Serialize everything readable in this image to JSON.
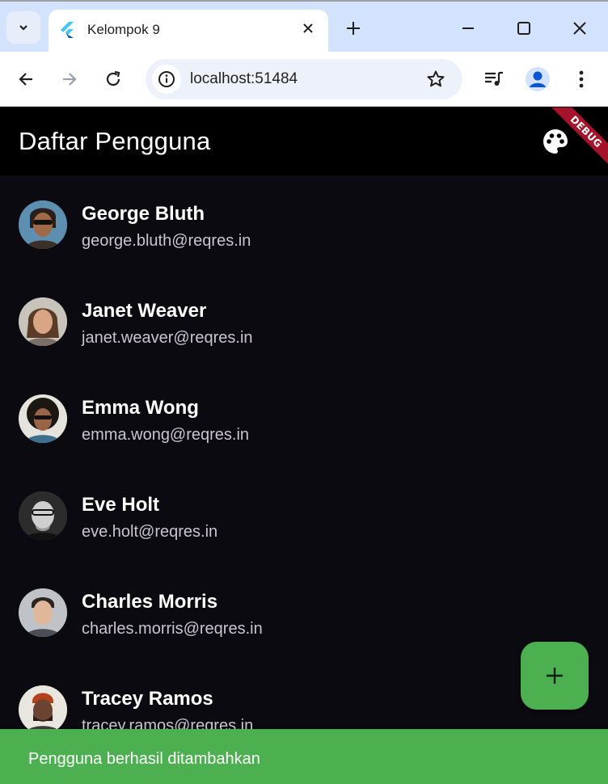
{
  "browser": {
    "tab_title": "Kelompok 9",
    "url": "localhost:51484",
    "icons": {
      "tab_search": "chevron-down-icon",
      "favicon": "flutter-icon",
      "tab_close": "close-icon",
      "new_tab": "plus-icon",
      "minimize": "minimize-icon",
      "maximize": "maximize-icon",
      "close_window": "close-icon",
      "back": "arrow-left-icon",
      "forward": "arrow-right-icon",
      "reload": "reload-icon",
      "site_info": "info-icon",
      "bookmark": "star-icon",
      "media": "media-queue-icon",
      "profile": "person-icon",
      "menu": "kebab-menu-icon"
    }
  },
  "app": {
    "title": "Daftar Pengguna",
    "debug_label": "DEBUG",
    "theme_icon": "palette-icon",
    "colors": {
      "appbar": "#000000",
      "background": "#0b0a10",
      "accent": "#4caf50",
      "debug": "#a5132b"
    },
    "users": [
      {
        "name": "George Bluth",
        "email": "george.bluth@reqres.in"
      },
      {
        "name": "Janet Weaver",
        "email": "janet.weaver@reqres.in"
      },
      {
        "name": "Emma Wong",
        "email": "emma.wong@reqres.in"
      },
      {
        "name": "Eve Holt",
        "email": "eve.holt@reqres.in"
      },
      {
        "name": "Charles Morris",
        "email": "charles.morris@reqres.in"
      },
      {
        "name": "Tracey Ramos",
        "email": "tracey.ramos@reqres.in"
      }
    ],
    "fab_icon": "plus-icon",
    "snackbar": {
      "message": "Pengguna berhasil ditambahkan"
    }
  }
}
